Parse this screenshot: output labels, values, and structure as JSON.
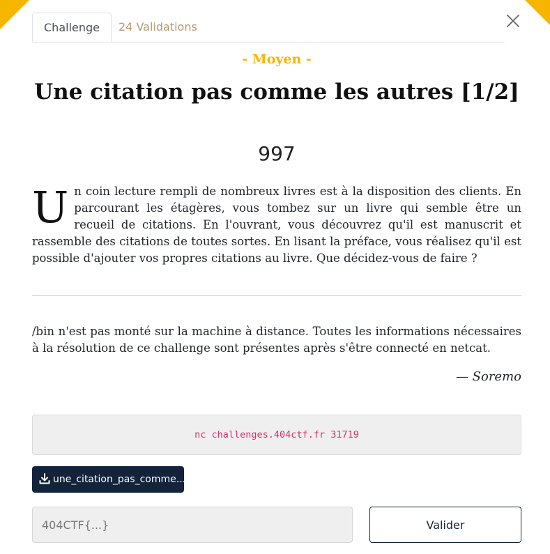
{
  "tabs": [
    {
      "label": "Challenge",
      "active": true
    },
    {
      "label": "24 Validations",
      "active": false
    }
  ],
  "challenge": {
    "difficulty": "- Moyen -",
    "title": "Une citation pas comme les autres [1/2]",
    "points": "997",
    "description_dropcap": "U",
    "description_rest": "n coin lecture rempli de nombreux livres est à la disposition des clients. En parcourant les étagères, vous tombez sur un livre qui semble être un recueil de citations. En l'ouvrant, vous découvrez qu'il est manuscrit et rassemble des citations de toutes sortes. En lisant la préface, vous réalisez qu'il est possible d'ajouter vos propres citations au livre. Que décidez-vous de faire ?",
    "note": "/bin n'est pas monté sur la machine à distance. Toutes les informations nécessaires à la résolution de ce challenge sont présentes après s'être connecté en netcat.",
    "author": "— Soremo",
    "connection_command": "nc challenges.404ctf.fr 31719",
    "download_label": "une_citation_pas_comme..."
  },
  "flag_form": {
    "placeholder": "404CTF{...}",
    "submit_label": "Valider"
  },
  "colors": {
    "accent": "#f7b500",
    "dark": "#12233a",
    "code": "#d6336c"
  },
  "icons": {
    "close": "close-icon",
    "download": "download-icon"
  }
}
